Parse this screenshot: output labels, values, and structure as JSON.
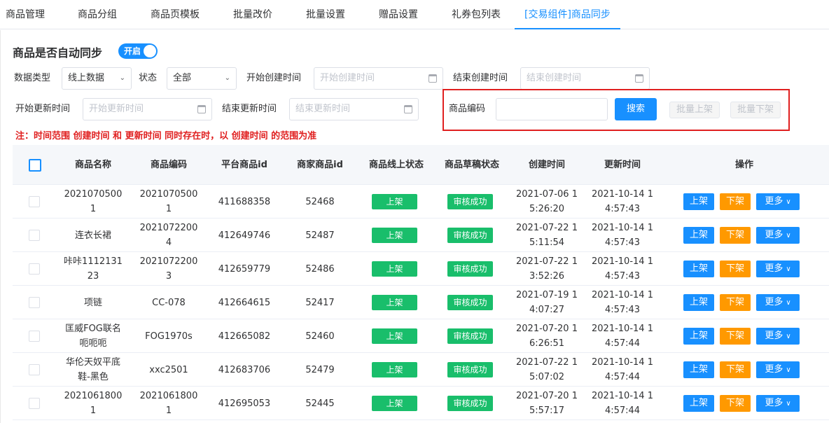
{
  "tabs": [
    {
      "label": "商品管理",
      "active": false
    },
    {
      "label": "商品分组",
      "active": false
    },
    {
      "label": "商品页模板",
      "active": false
    },
    {
      "label": "批量改价",
      "active": false
    },
    {
      "label": "批量设置",
      "active": false
    },
    {
      "label": "赠品设置",
      "active": false
    },
    {
      "label": "礼券包列表",
      "active": false
    },
    {
      "label": "[交易组件]商品同步",
      "active": true
    }
  ],
  "sync": {
    "title": "商品是否自动同步",
    "switch_label": "开启",
    "switch_on": true
  },
  "filters": {
    "data_type_label": "数据类型",
    "data_type_value": "线上数据",
    "status_label": "状态",
    "status_value": "全部",
    "create_start_label": "开始创建时间",
    "create_start_placeholder": "开始创建时间",
    "create_end_label": "结束创建时间",
    "create_end_placeholder": "结束创建时间",
    "update_start_label": "开始更新时间",
    "update_start_placeholder": "开始更新时间",
    "update_end_label": "结束更新时间",
    "update_end_placeholder": "结束更新时间",
    "code_label": "商品编码",
    "code_value": "",
    "search_label": "搜索",
    "batch_on_label": "批量上架",
    "batch_off_label": "批量下架"
  },
  "note": "注：时间范围 创建时间 和 更新时间 同时存在时，以 创建时间 的范围为准",
  "colors": {
    "primary": "#1890ff",
    "success": "#19be6b",
    "warning": "#ff9900",
    "danger": "#e02020"
  },
  "table": {
    "headers": [
      "商品名称",
      "商品编码",
      "平台商品id",
      "商家商品id",
      "商品线上状态",
      "商品草稿状态",
      "创建时间",
      "更新时间",
      "操作"
    ],
    "op_labels": {
      "on": "上架",
      "off": "下架",
      "more": "更多"
    },
    "rows": [
      {
        "name": "20210705001",
        "code": "20210705001",
        "platform_id": "411688358",
        "merchant_id": "52468",
        "online": "上架",
        "draft": "审核成功",
        "created": "2021-07-06 15:26:20",
        "updated": "2021-10-14 14:57:43"
      },
      {
        "name": "连衣长裙",
        "code": "20210722004",
        "platform_id": "412649746",
        "merchant_id": "52487",
        "online": "上架",
        "draft": "审核成功",
        "created": "2021-07-22 15:11:54",
        "updated": "2021-10-14 14:57:43"
      },
      {
        "name": "咔咔111213123",
        "code": "20210722003",
        "platform_id": "412659779",
        "merchant_id": "52486",
        "online": "上架",
        "draft": "审核成功",
        "created": "2021-07-22 13:52:26",
        "updated": "2021-10-14 14:57:43"
      },
      {
        "name": "项链",
        "code": "CC-078",
        "platform_id": "412664615",
        "merchant_id": "52417",
        "online": "上架",
        "draft": "审核成功",
        "created": "2021-07-19 14:07:27",
        "updated": "2021-10-14 14:57:43"
      },
      {
        "name": "匡威FOG联名呃呃呃",
        "code": "FOG1970s",
        "platform_id": "412665082",
        "merchant_id": "52460",
        "online": "上架",
        "draft": "审核成功",
        "created": "2021-07-20 16:26:51",
        "updated": "2021-10-14 14:57:44"
      },
      {
        "name": "华伦天奴平底鞋-黑色",
        "code": "xxc2501",
        "platform_id": "412683706",
        "merchant_id": "52479",
        "online": "上架",
        "draft": "审核成功",
        "created": "2021-07-22 15:07:02",
        "updated": "2021-10-14 14:57:44"
      },
      {
        "name": "20210618001",
        "code": "20210618001",
        "platform_id": "412695053",
        "merchant_id": "52445",
        "online": "上架",
        "draft": "审核成功",
        "created": "2021-07-20 15:57:17",
        "updated": "2021-10-14 14:57:44"
      }
    ]
  }
}
